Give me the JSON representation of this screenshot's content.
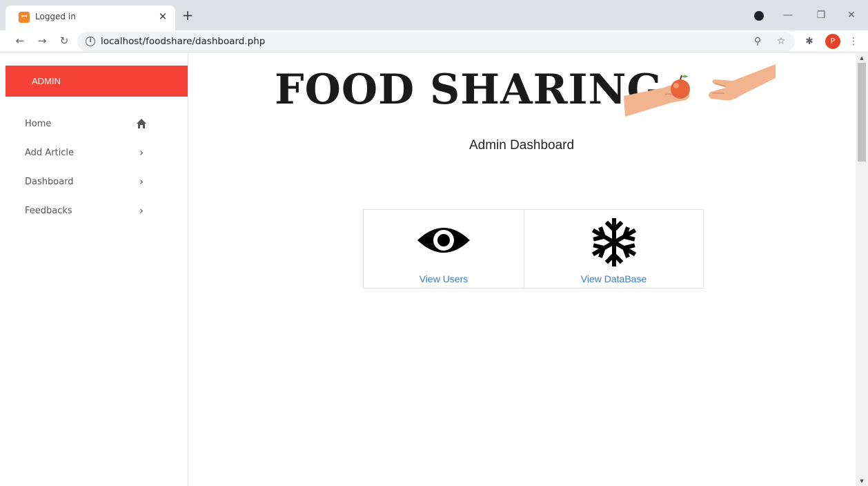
{
  "browser": {
    "tab_title": "Logged in",
    "tab_favicon": "xampp-icon",
    "url": "localhost/foodshare/dashboard.php",
    "profile_initial": "P"
  },
  "sidebar": {
    "header": "ADMIN",
    "items": [
      {
        "label": "Home",
        "icon": "home-icon"
      },
      {
        "label": "Add Article",
        "icon": "chevron-right-icon"
      },
      {
        "label": "Dashboard",
        "icon": "chevron-right-icon"
      },
      {
        "label": "Feedbacks",
        "icon": "chevron-right-icon"
      }
    ]
  },
  "main": {
    "title": "FOOD SHARING",
    "subtitle": "Admin Dashboard",
    "cards": [
      {
        "label": "View Users",
        "icon": "eye-icon"
      },
      {
        "label": "View DataBase",
        "icon": "snowflake-icon"
      }
    ]
  },
  "colors": {
    "accent": "#f44336",
    "link": "#3a7dc9"
  }
}
